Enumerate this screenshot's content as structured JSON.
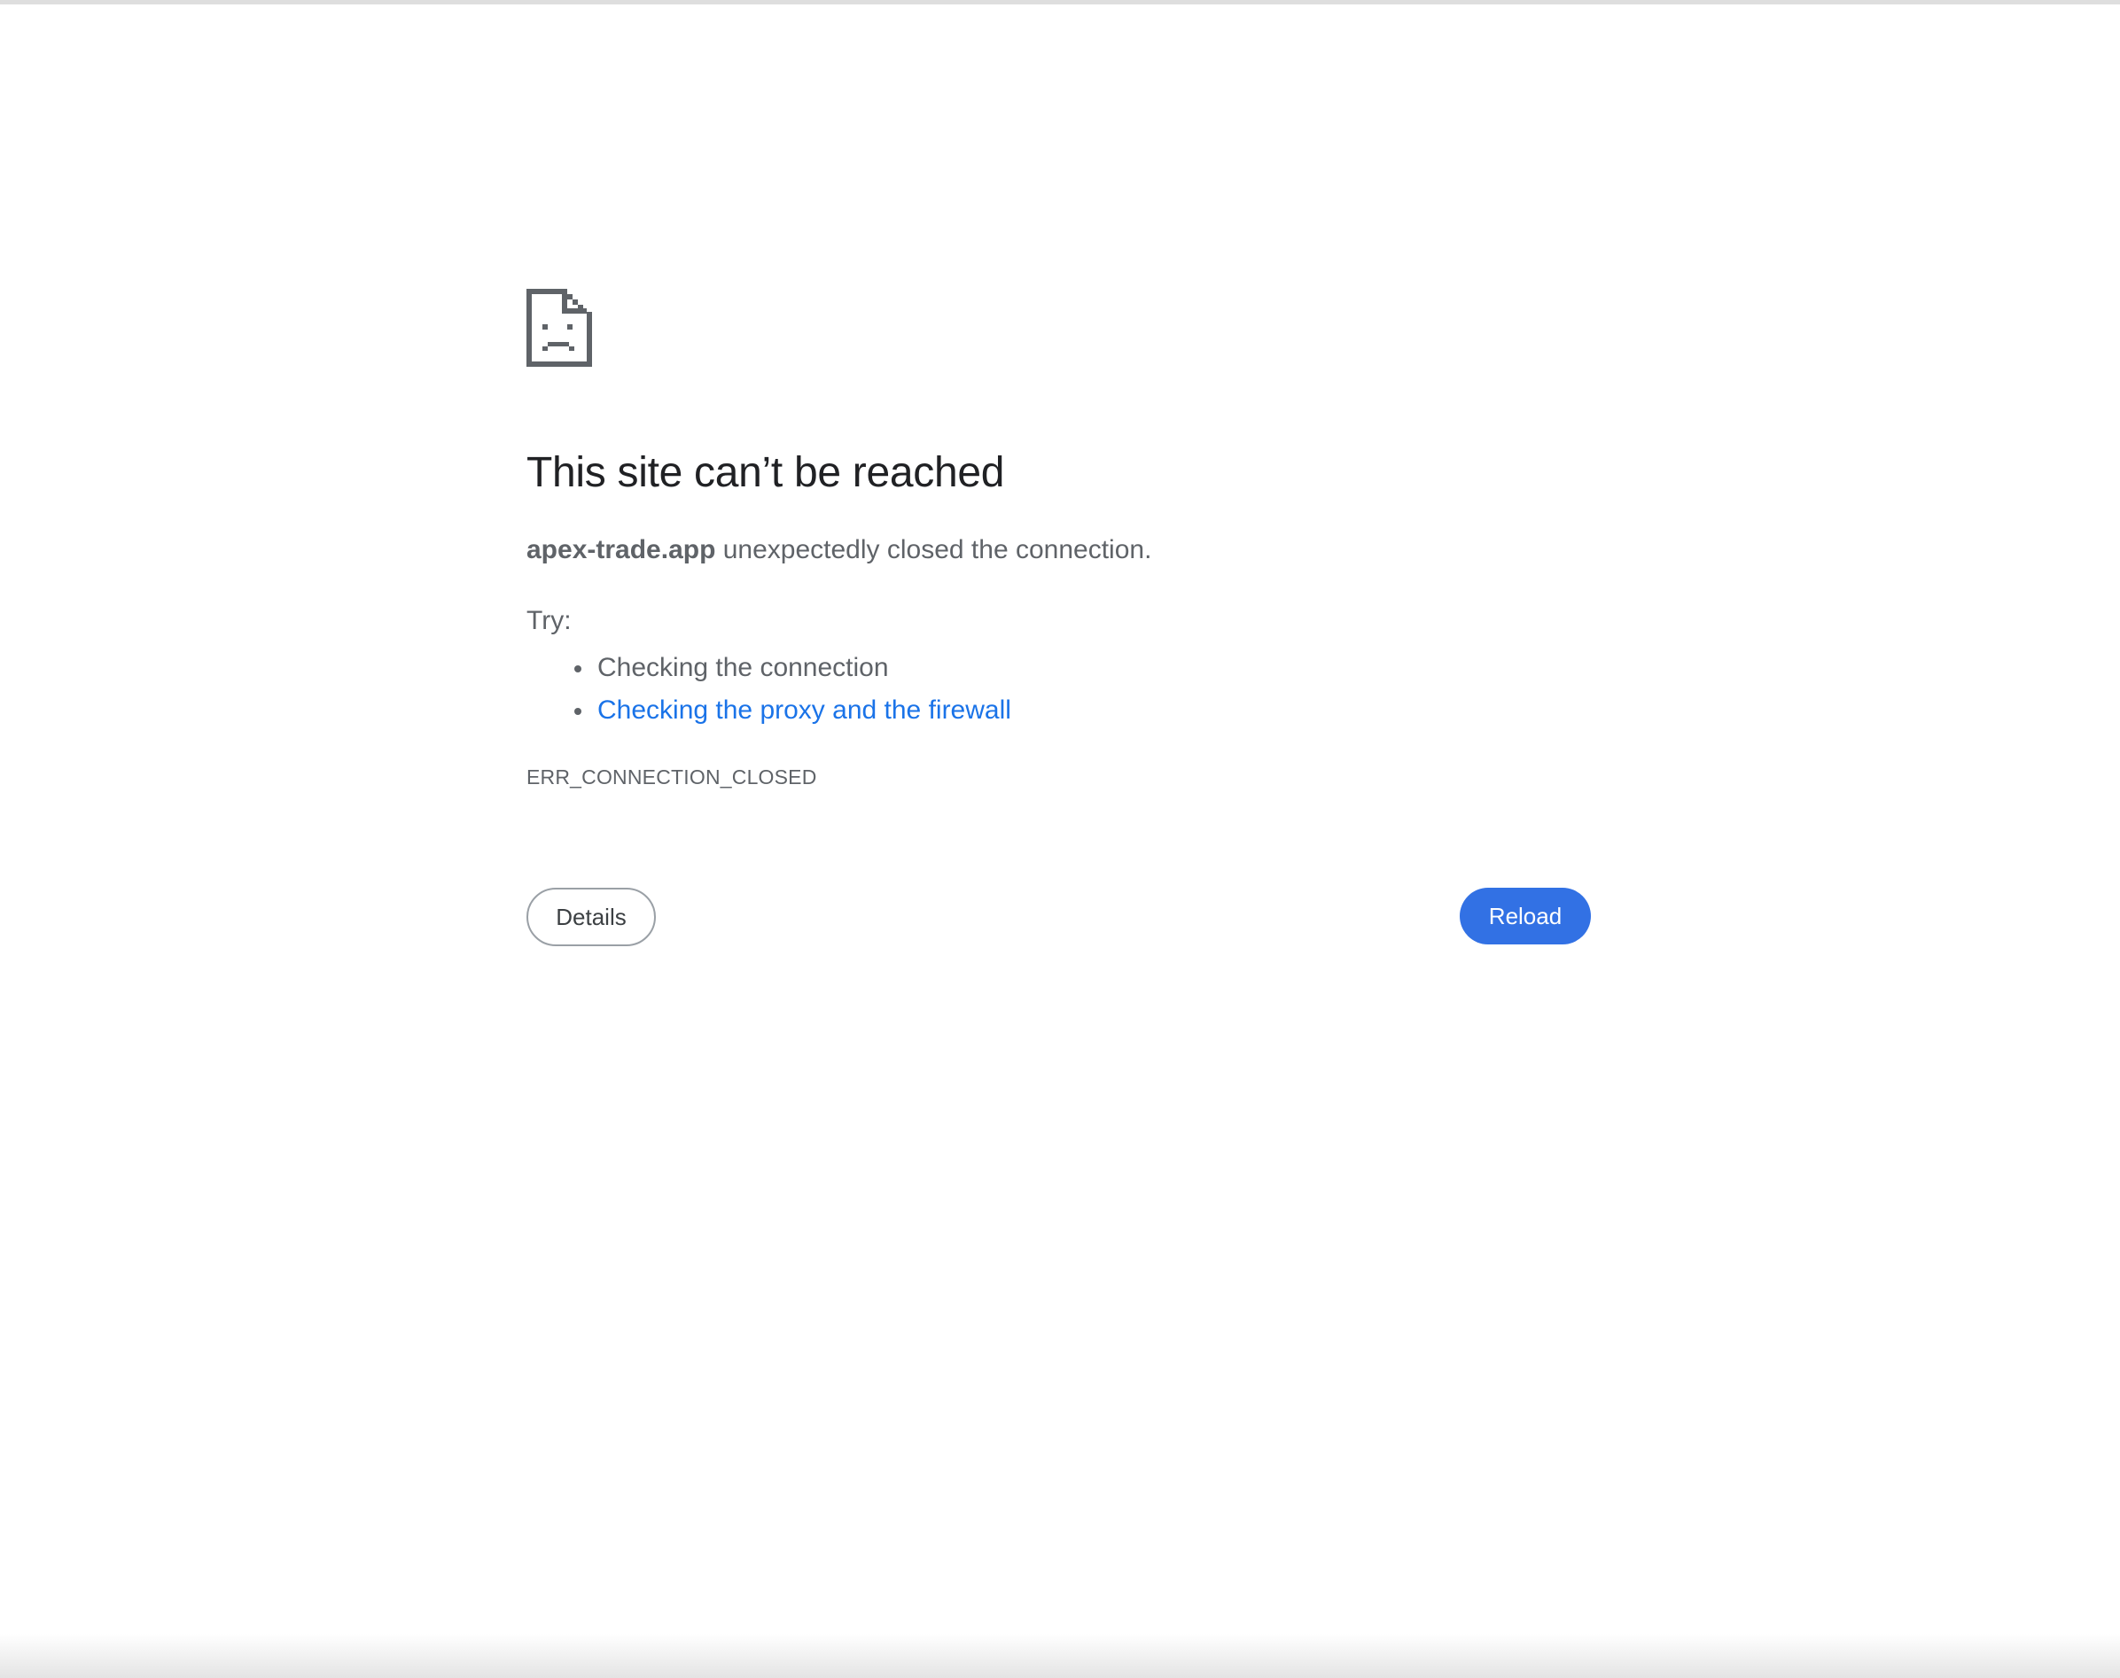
{
  "page": {
    "icon": "sad-document-icon",
    "title": "This site can’t be reached",
    "host": "apex-trade.app",
    "summary_rest": " unexpectedly closed the connection.",
    "try_label": "Try:",
    "suggestions": [
      {
        "text": "Checking the connection",
        "is_link": false
      },
      {
        "text": "Checking the proxy and the firewall",
        "is_link": true
      }
    ],
    "error_code": "ERR_CONNECTION_CLOSED",
    "details_label": "Details",
    "reload_label": "Reload"
  },
  "colors": {
    "accent": "#3271e4",
    "link": "#1a73e8",
    "title_text": "#202124",
    "body_text": "#5f6368",
    "icon": "#5f6368"
  }
}
